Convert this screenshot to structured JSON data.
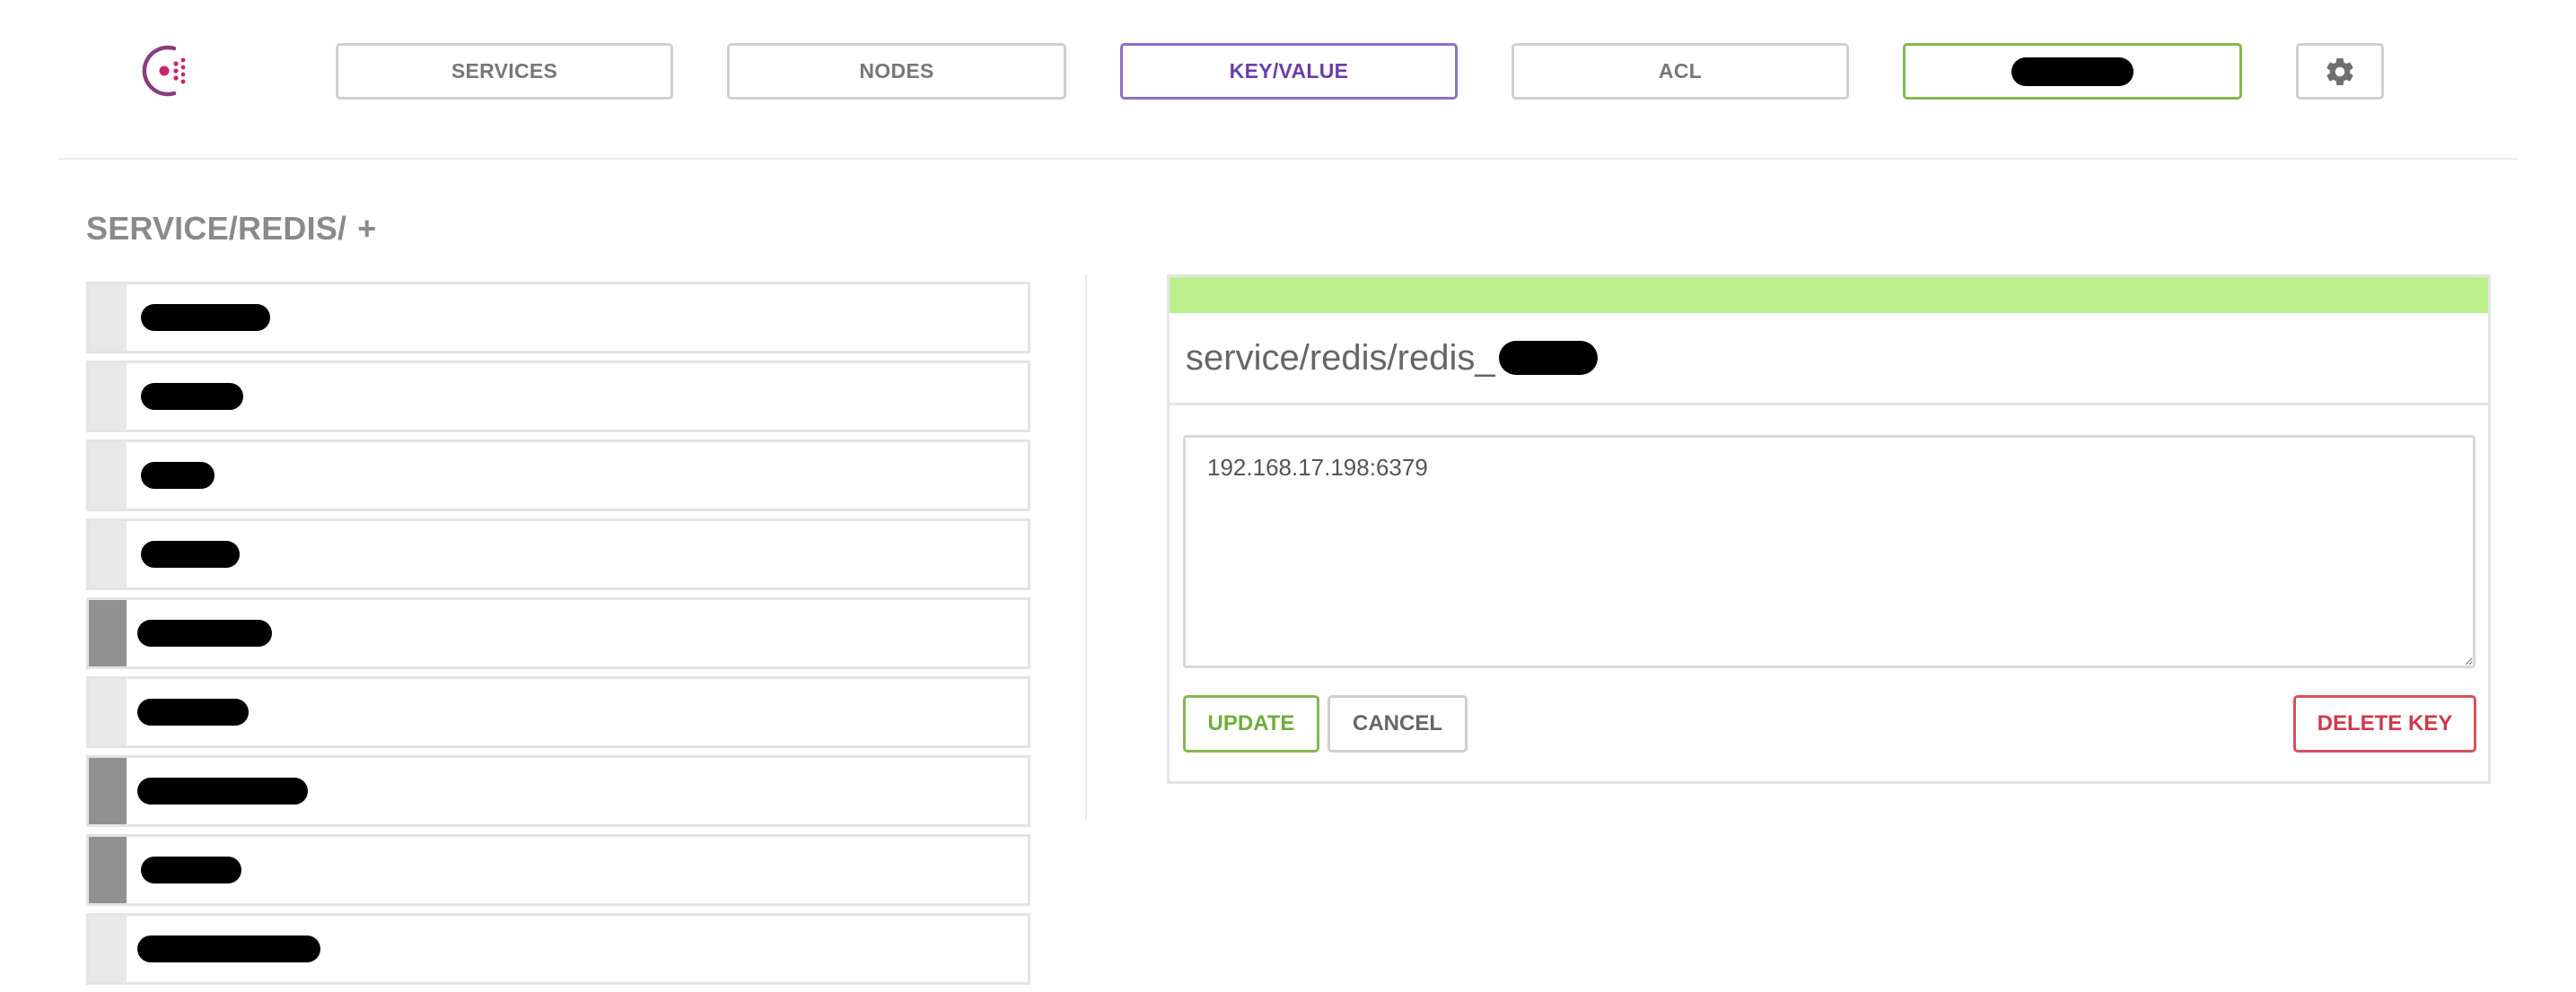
{
  "nav": {
    "services": "SERVICES",
    "nodes": "NODES",
    "key_value": "KEY/VALUE",
    "acl": "ACL"
  },
  "breadcrumb": {
    "path": "SERVICE/REDIS/",
    "add": "+"
  },
  "keys": [
    {
      "type": "key"
    },
    {
      "type": "key"
    },
    {
      "type": "key"
    },
    {
      "type": "key"
    },
    {
      "type": "folder"
    },
    {
      "type": "key"
    },
    {
      "type": "folder"
    },
    {
      "type": "folder"
    },
    {
      "type": "key"
    }
  ],
  "editor": {
    "key_prefix": "service/redis/redis_",
    "value": "192.168.17.198:6379",
    "update_label": "UPDATE",
    "cancel_label": "CANCEL",
    "delete_label": "DELETE KEY"
  },
  "colors": {
    "accent": "#6a3ea6",
    "success": "#6fae3e",
    "status_bar": "#bdf08c",
    "danger": "#d0394b"
  },
  "icons": {
    "logo": "consul-logo-icon",
    "settings": "gear-icon"
  }
}
